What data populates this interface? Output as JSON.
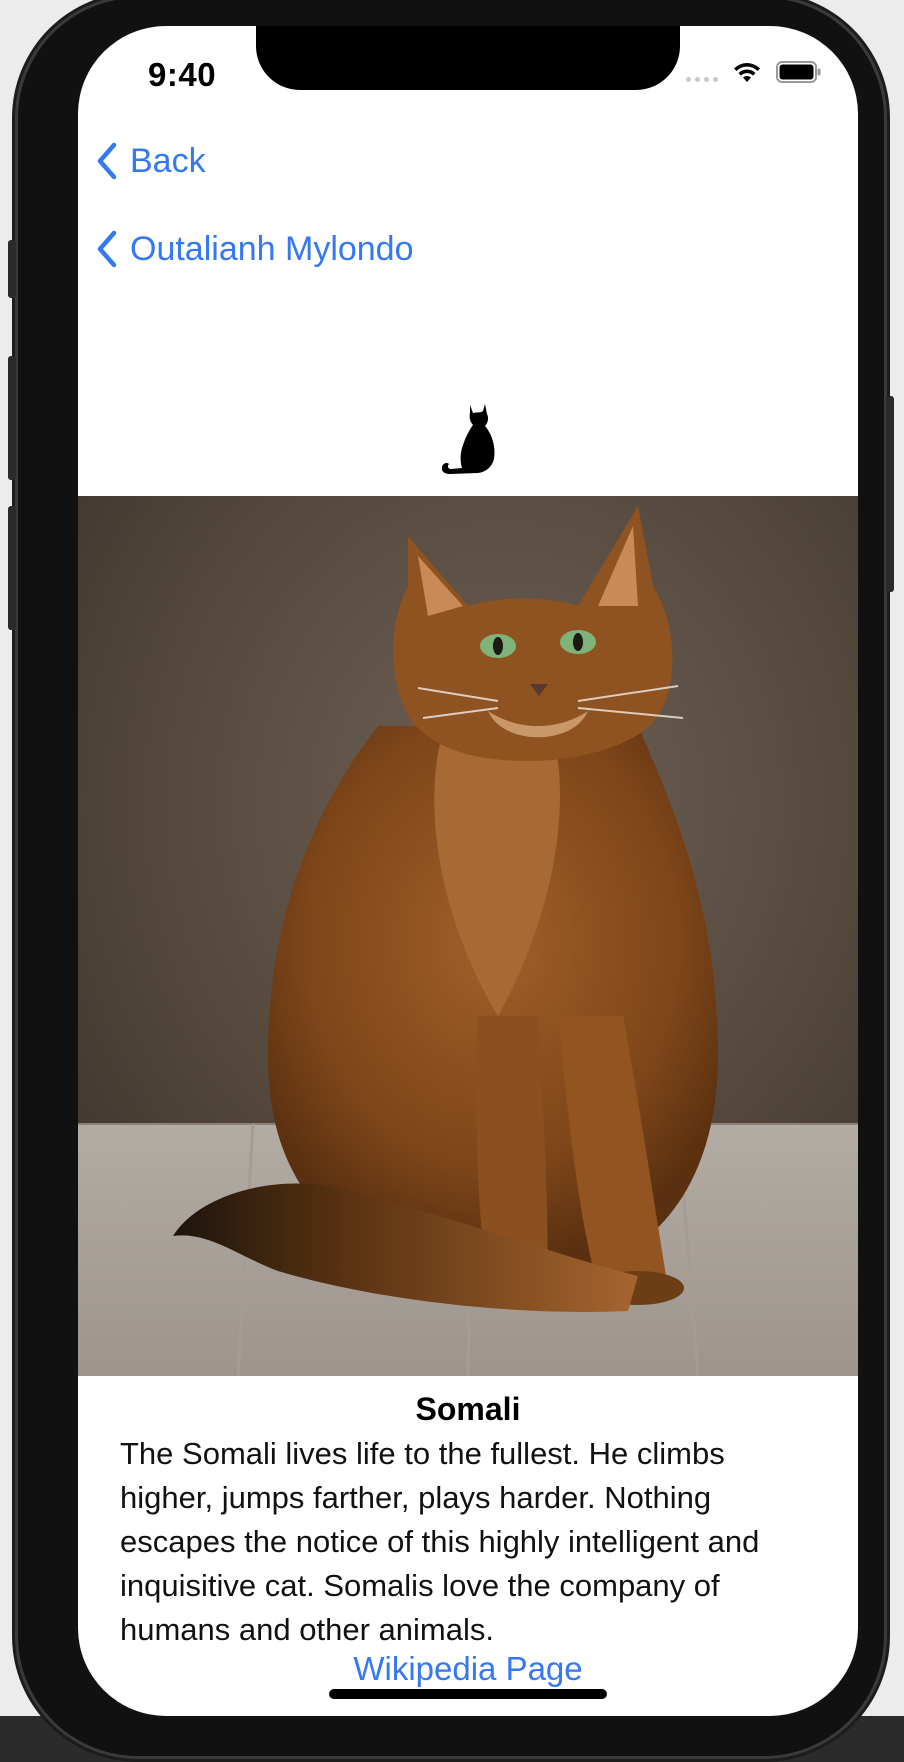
{
  "status_bar": {
    "time": "9:40",
    "icons": [
      "cellular-dots-icon",
      "wifi-icon",
      "battery-icon"
    ]
  },
  "navigation": {
    "back_label": "Back",
    "parent_label": "Outalianh Mylondo"
  },
  "breed": {
    "icon": "cat-silhouette-icon",
    "photo_alt": "Somali",
    "name": "Somali",
    "description": "The Somali lives life to the fullest. He climbs higher, jumps farther, plays harder. Nothing escapes the notice of this highly intelligent and inquisitive cat. Somalis love the company of humans and other animals.",
    "link_label": "Wikipedia Page"
  },
  "colors": {
    "accent": "#3478f6",
    "background": "#ffffff",
    "device_frame": "#111111"
  }
}
